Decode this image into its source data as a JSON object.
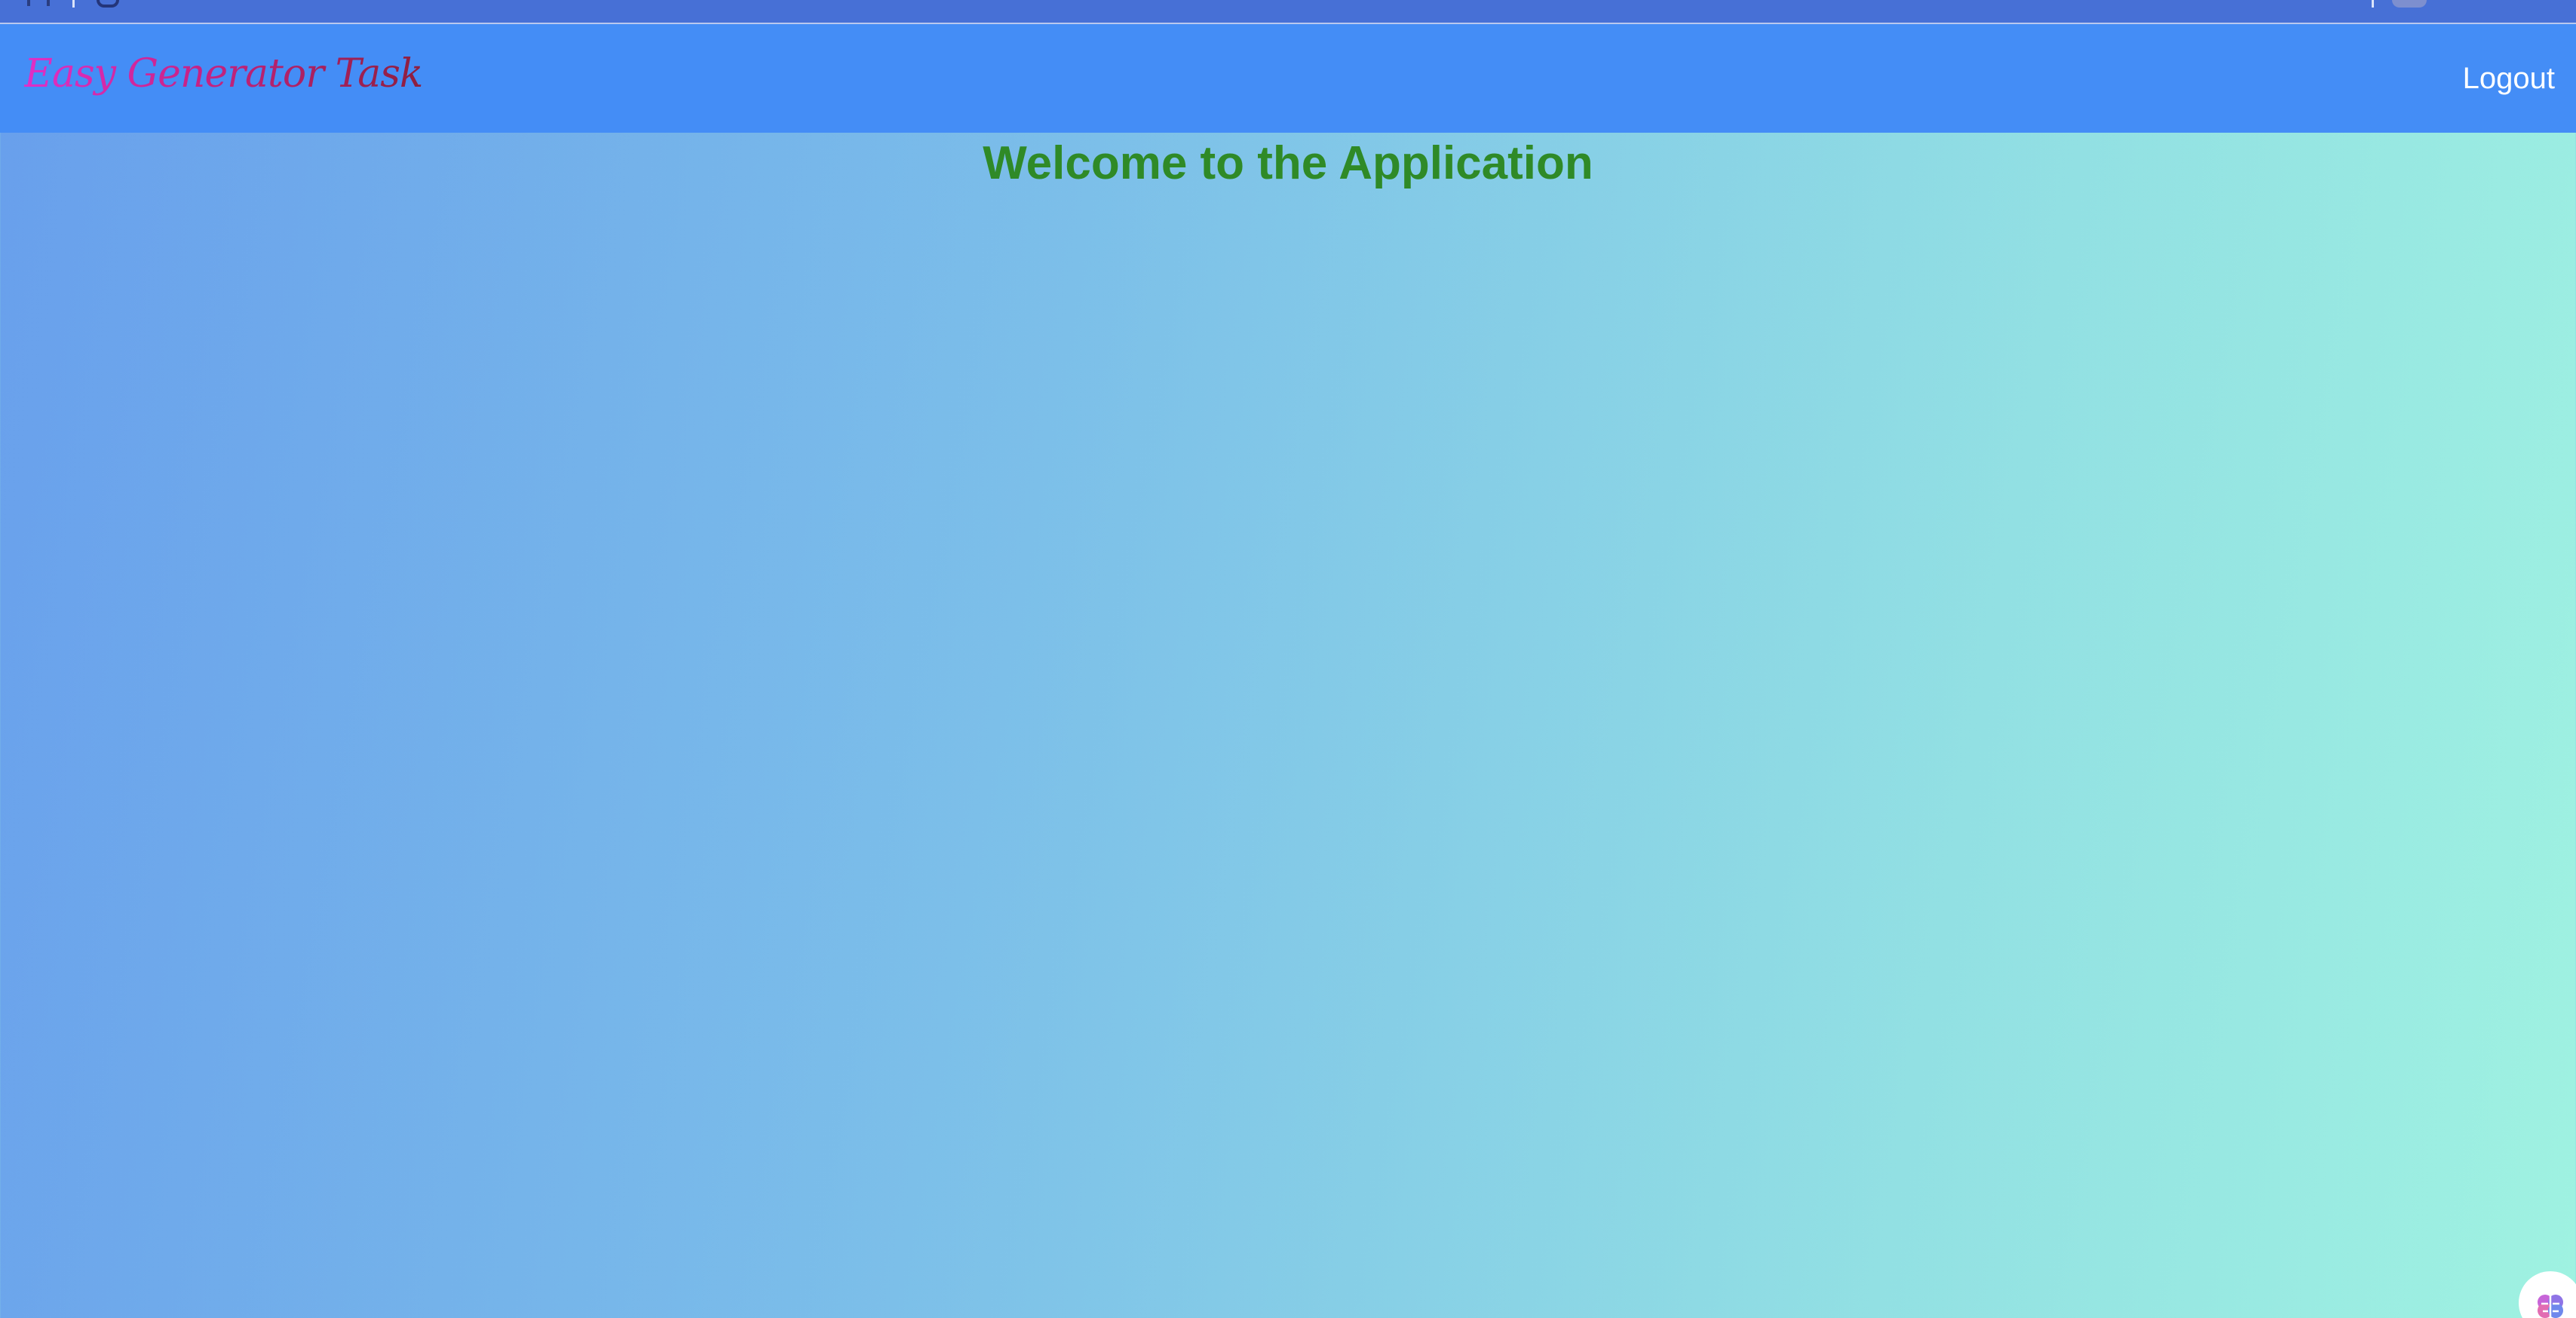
{
  "brand": {
    "title": "Easy Generator Task"
  },
  "header": {
    "logout_label": "Logout"
  },
  "main": {
    "heading": "Welcome to the Application"
  },
  "icons": {
    "browser_apps": "grid-icon",
    "browser_reload": "reload-icon",
    "profile": "avatar",
    "extension": "brain-icon"
  },
  "colors": {
    "navbar": "#448df6",
    "heading": "#2f8a27",
    "brand_start": "#e02fc8",
    "brand_end": "#8d1f3e",
    "gradient_start": "#689fec",
    "gradient_end": "#9ff2e1"
  }
}
